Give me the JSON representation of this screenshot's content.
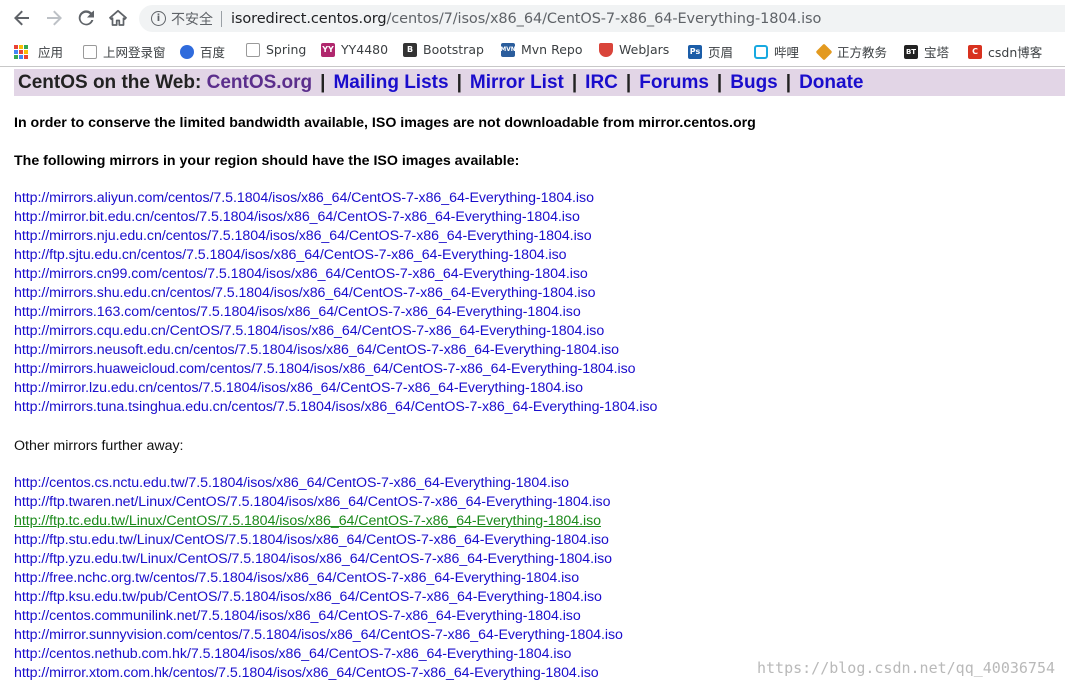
{
  "toolbar": {
    "security_label": "不安全",
    "info_glyph": "i",
    "url_host": "isoredirect.centos.org",
    "url_path": "/centos/7/isos/x86_64/CentOS-7-x86_64-Everything-1804.iso"
  },
  "bookmarks": [
    {
      "label": "应用",
      "icon": "apps-grid-icon"
    },
    {
      "label": "上网登录窗",
      "icon": "page-icon",
      "glyph": "",
      "color": "#7a7a7a"
    },
    {
      "label": "百度",
      "icon": "baidu-paw-icon",
      "glyph": "",
      "color": "#2f6bdc"
    },
    {
      "label": "Spring",
      "icon": "page-icon",
      "glyph": "",
      "color": "#7a7a7a"
    },
    {
      "label": "YY4480",
      "icon": "yy-icon",
      "glyph": "YY",
      "color": "#b0276d"
    },
    {
      "label": "Bootstrap",
      "icon": "bootstrap-icon",
      "glyph": "B",
      "color": "#333"
    },
    {
      "label": "Mvn Repo",
      "icon": "mvn-icon",
      "glyph": "MVN",
      "color": "#2a5d9c"
    },
    {
      "label": "WebJars",
      "icon": "webjars-shield-icon",
      "glyph": "",
      "color": "#d9443a"
    },
    {
      "label": "页眉",
      "icon": "ps-icon",
      "glyph": "Ps",
      "color": "#1b5da8"
    },
    {
      "label": "哔哩",
      "icon": "bilibili-tv-icon",
      "glyph": "",
      "color": "#18a9e0"
    },
    {
      "label": "正方教务",
      "icon": "zhengfang-icon",
      "glyph": "",
      "color": "#e39a1f"
    },
    {
      "label": "宝塔",
      "icon": "bt-icon",
      "glyph": "BT",
      "color": "#222"
    },
    {
      "label": "csdn博客",
      "icon": "csdn-icon",
      "glyph": "C",
      "color": "#d8321f"
    }
  ],
  "banner": {
    "lead": "CentOS on the Web:",
    "links": [
      "CentOS.org",
      "Mailing Lists",
      "Mirror List",
      "IRC",
      "Forums",
      "Bugs",
      "Donate"
    ],
    "separator": "|"
  },
  "content": {
    "notice": "In order to conserve the limited bandwidth available, ISO images are not downloadable from mirror.centos.org",
    "region_heading": "The following mirrors in your region should have the ISO images available:",
    "away_heading": "Other mirrors further away:",
    "region_mirrors": [
      "http://mirrors.aliyun.com/centos/7.5.1804/isos/x86_64/CentOS-7-x86_64-Everything-1804.iso",
      "http://mirror.bit.edu.cn/centos/7.5.1804/isos/x86_64/CentOS-7-x86_64-Everything-1804.iso",
      "http://mirrors.nju.edu.cn/centos/7.5.1804/isos/x86_64/CentOS-7-x86_64-Everything-1804.iso",
      "http://ftp.sjtu.edu.cn/centos/7.5.1804/isos/x86_64/CentOS-7-x86_64-Everything-1804.iso",
      "http://mirrors.cn99.com/centos/7.5.1804/isos/x86_64/CentOS-7-x86_64-Everything-1804.iso",
      "http://mirrors.shu.edu.cn/centos/7.5.1804/isos/x86_64/CentOS-7-x86_64-Everything-1804.iso",
      "http://mirrors.163.com/centos/7.5.1804/isos/x86_64/CentOS-7-x86_64-Everything-1804.iso",
      "http://mirrors.cqu.edu.cn/CentOS/7.5.1804/isos/x86_64/CentOS-7-x86_64-Everything-1804.iso",
      "http://mirrors.neusoft.edu.cn/centos/7.5.1804/isos/x86_64/CentOS-7-x86_64-Everything-1804.iso",
      "http://mirrors.huaweicloud.com/centos/7.5.1804/isos/x86_64/CentOS-7-x86_64-Everything-1804.iso",
      "http://mirror.lzu.edu.cn/centos/7.5.1804/isos/x86_64/CentOS-7-x86_64-Everything-1804.iso",
      "http://mirrors.tuna.tsinghua.edu.cn/centos/7.5.1804/isos/x86_64/CentOS-7-x86_64-Everything-1804.iso"
    ],
    "away_mirrors": [
      "http://centos.cs.nctu.edu.tw/7.5.1804/isos/x86_64/CentOS-7-x86_64-Everything-1804.iso",
      "http://ftp.twaren.net/Linux/CentOS/7.5.1804/isos/x86_64/CentOS-7-x86_64-Everything-1804.iso",
      "http://ftp.tc.edu.tw/Linux/CentOS/7.5.1804/isos/x86_64/CentOS-7-x86_64-Everything-1804.iso",
      "http://ftp.stu.edu.tw/Linux/CentOS/7.5.1804/isos/x86_64/CentOS-7-x86_64-Everything-1804.iso",
      "http://ftp.yzu.edu.tw/Linux/CentOS/7.5.1804/isos/x86_64/CentOS-7-x86_64-Everything-1804.iso",
      "http://free.nchc.org.tw/centos/7.5.1804/isos/x86_64/CentOS-7-x86_64-Everything-1804.iso",
      "http://ftp.ksu.edu.tw/pub/CentOS/7.5.1804/isos/x86_64/CentOS-7-x86_64-Everything-1804.iso",
      "http://centos.communilink.net/7.5.1804/isos/x86_64/CentOS-7-x86_64-Everything-1804.iso",
      "http://mirror.sunnyvision.com/centos/7.5.1804/isos/x86_64/CentOS-7-x86_64-Everything-1804.iso",
      "http://centos.nethub.com.hk/7.5.1804/isos/x86_64/CentOS-7-x86_64-Everything-1804.iso",
      "http://mirror.xtom.com.hk/centos/7.5.1804/isos/x86_64/CentOS-7-x86_64-Everything-1804.iso"
    ],
    "visited_away_index": 2
  },
  "watermark": "https://blog.csdn.net/qq_40036754",
  "colors": {
    "link": "#1a0dcc",
    "visited_link": "#1c8a1c",
    "banner_bg": "#e2d5e6",
    "site_link": "#5b2e8c"
  }
}
